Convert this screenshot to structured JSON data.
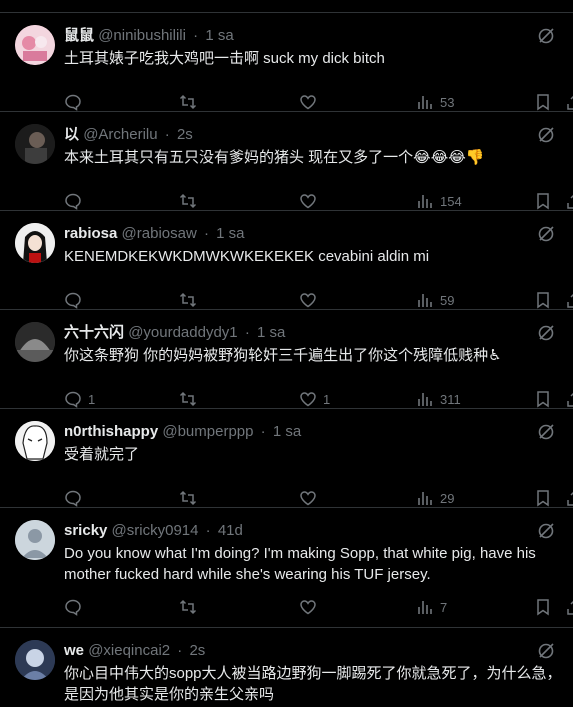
{
  "posts": [
    {
      "name": "鼠鼠",
      "handle": "@ninibushilili",
      "time": "1 sa",
      "text": "土耳其婊子吃我大鸡吧一击啊 suck my dick bitch",
      "replies": "",
      "reposts": "",
      "likes": "",
      "views": "53",
      "avatar_color": "#e8b9c8"
    },
    {
      "name": "以",
      "handle": "@Archerilu",
      "time": "2s",
      "text": "本来土耳其只有五只没有爹妈的猪头 现在又多了一个😂😂😂👎",
      "replies": "",
      "reposts": "",
      "likes": "",
      "views": "154",
      "avatar_color": "#3a3a3a"
    },
    {
      "name": "rabiosa",
      "handle": "@rabiosaw",
      "time": "1 sa",
      "text": "KENEMDKEKWKDMWKWKEKEKEK cevabini aldin mi",
      "replies": "",
      "reposts": "",
      "likes": "",
      "views": "59",
      "avatar_color": "#d9d9d9"
    },
    {
      "name": "六十六闪",
      "handle": "@yourdaddydy1",
      "time": "1 sa",
      "text": "你这条野狗 你的妈妈被野狗轮奸三千遍生出了你这个残障低贱种♿",
      "replies": "1",
      "reposts": "",
      "likes": "1",
      "views": "311",
      "avatar_color": "#555555"
    },
    {
      "name": "n0rthishappy",
      "handle": "@bumperppp",
      "time": "1 sa",
      "text": "受着就完了",
      "replies": "",
      "reposts": "",
      "likes": "",
      "views": "29",
      "avatar_color": "#e0e0e0"
    },
    {
      "name": "sricky",
      "handle": "@sricky0914",
      "time": "41d",
      "text": "Do you know what I'm doing? I'm making Sopp, that white pig, have his mother fucked hard while she's wearing his TUF jersey.",
      "replies": "",
      "reposts": "",
      "likes": "",
      "views": "7",
      "avatar_color": "#ccd6dd"
    },
    {
      "name": "we",
      "handle": "@xieqincai2",
      "time": "2s",
      "text": "你心目中伟大的sopp大人被当路边野狗一脚踢死了你就急死了，为什么急，是因为他其实是你的亲生父亲吗",
      "replies": "",
      "reposts": "",
      "likes": "",
      "views": "",
      "avatar_color": "#3b4a6b"
    }
  ],
  "icons": {
    "reply": "reply-icon",
    "repost": "repost-icon",
    "like": "like-icon",
    "views": "views-icon",
    "bookmark": "bookmark-icon",
    "share": "share-icon",
    "grok": "grok-icon"
  },
  "colors": {
    "background": "#000000",
    "text": "#e7e9ea",
    "secondary": "#71767b",
    "divider": "#2f3336"
  }
}
